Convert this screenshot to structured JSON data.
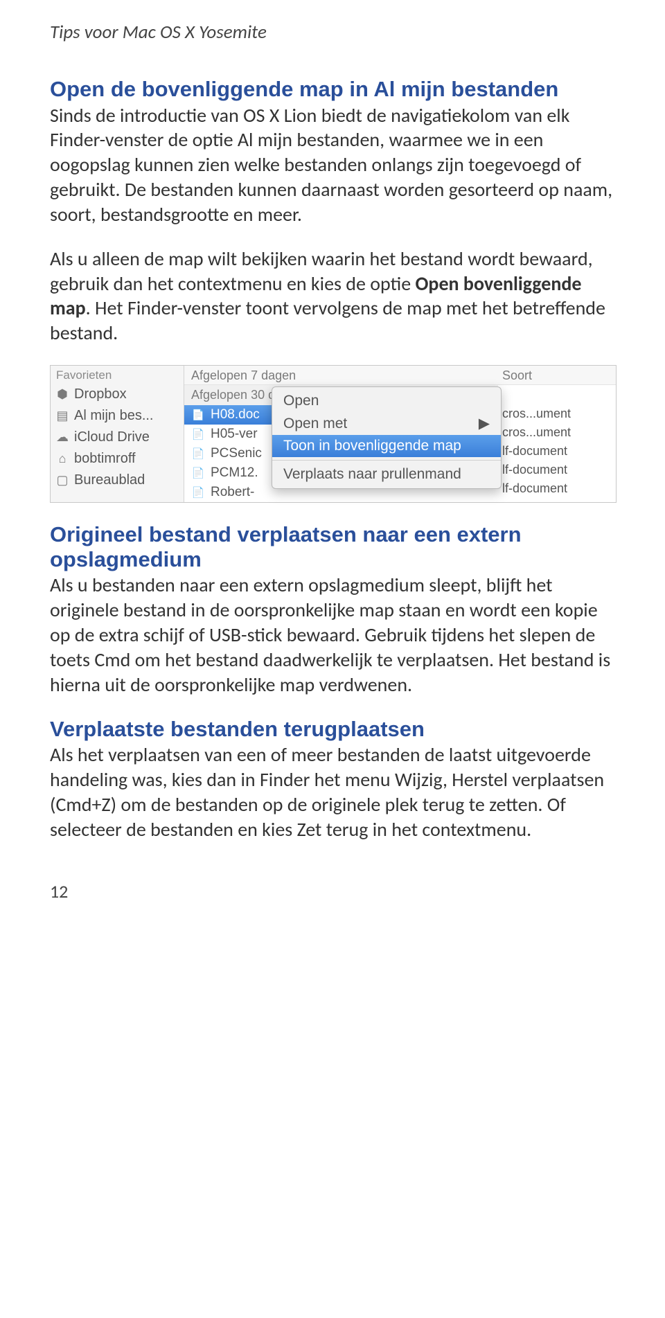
{
  "header": {
    "title": "Tips voor Mac OS X Yosemite"
  },
  "section1": {
    "heading": "Open de bovenliggende map in Al mijn bestanden",
    "p1": "Sinds de introductie van OS X Lion biedt de navigatiekolom van elk Finder-venster de optie Al mijn bestanden, waarmee we in een oogopslag kunnen zien welke bestanden onlangs zijn toegevoegd of gebruikt. De bestanden kunnen daarnaast worden gesorteerd op naam, soort, bestandsgrootte en meer.",
    "p2a": "Als u alleen de map wilt bekijken waarin het bestand wordt bewaard, gebruik dan het contextmenu en kies de optie ",
    "p2bold": "Open bovenliggende map",
    "p2b": ". Het Finder-venster toont vervolgens de map met het betreffende bestand."
  },
  "screenshot": {
    "sidebar_header": "Favorieten",
    "sidebar": [
      "Dropbox",
      "Al mijn bes...",
      "iCloud Drive",
      "bobtimroff",
      "Bureaublad"
    ],
    "col_left": "Afgelopen 7 dagen",
    "col_right": "Soort",
    "group": "Afgelopen 30 dagen",
    "files": [
      "H08.doc",
      "H05-ver",
      "PCSenic",
      "PCM12.",
      "Robert-"
    ],
    "right": [
      "cros...ument",
      "cros...ument",
      "lf-document",
      "lf-document",
      "lf-document"
    ],
    "menu": {
      "open": "Open",
      "open_with": "Open met",
      "show_parent": "Toon in bovenliggende map",
      "trash": "Verplaats naar prullenmand"
    }
  },
  "section2": {
    "heading": "Origineel bestand verplaatsen naar een extern opslagmedium",
    "p_a": "Als u bestanden naar een extern opslagmedium sleept, blijft het originele bestand in de oorspronkelijke map staan en wordt een kopie op de extra schijf of USB-stick bewaard. Gebruik tijdens het slepen de toets ",
    "p_bold1": "Cmd",
    "p_b": " om het bestand daadwerkelijk te verplaatsen. Het bestand is hierna uit de oorspronkelijke map verdwenen."
  },
  "section3": {
    "heading": "Verplaatste bestanden terugplaatsen",
    "p_a": "Als het verplaatsen van een of meer bestanden de laatst uitgevoerde handeling was, kies dan in ",
    "p_bold1": "Finder",
    "p_b": " het menu ",
    "p_bold2": "Wijzig",
    "p_c": ", ",
    "p_bold3": "Herstel verplaatsen",
    "p_d": " (",
    "p_bold4": "Cmd+Z",
    "p_e": ") om de bestanden op de originele plek terug te zetten. Of selecteer de bestanden en kies ",
    "p_bold5": "Zet terug",
    "p_f": " in het contextmenu."
  },
  "page_number": "12"
}
